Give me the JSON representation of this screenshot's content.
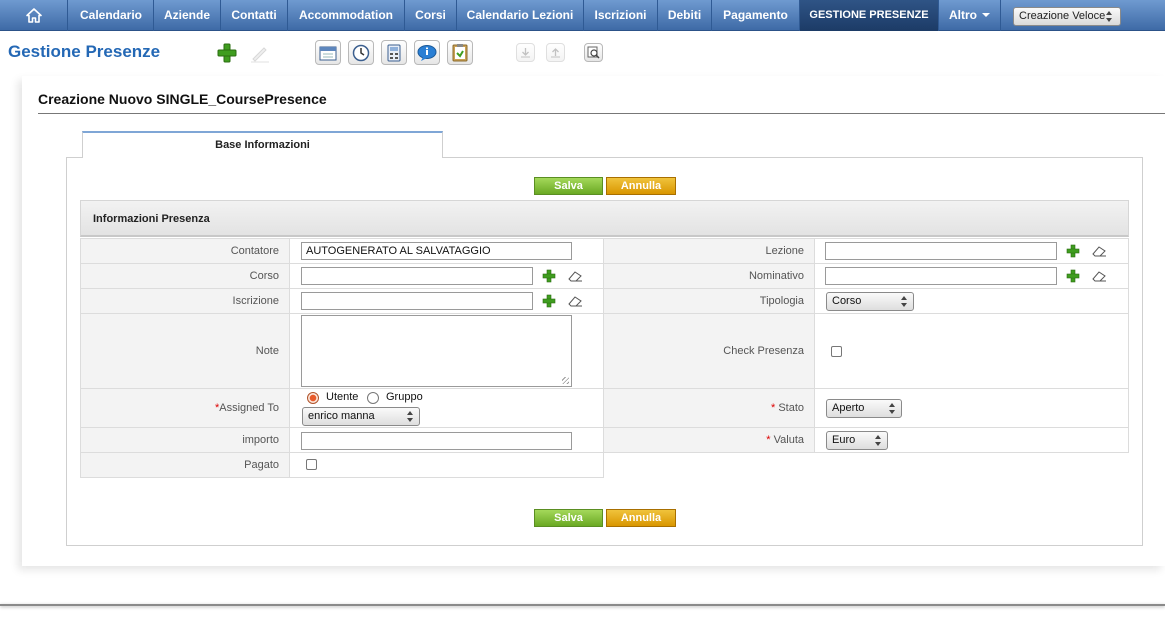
{
  "nav": {
    "home_icon": "home-icon",
    "items": [
      {
        "label": "Calendario",
        "active": false
      },
      {
        "label": "Aziende",
        "active": false
      },
      {
        "label": "Contatti",
        "active": false
      },
      {
        "label": "Accommodation",
        "active": false
      },
      {
        "label": "Corsi",
        "active": false
      },
      {
        "label": "Calendario Lezioni",
        "active": false
      },
      {
        "label": "Iscrizioni",
        "active": false
      },
      {
        "label": "Debiti",
        "active": false
      },
      {
        "label": "Pagamento",
        "active": false
      },
      {
        "label": "GESTIONE PRESENZE",
        "active": true
      },
      {
        "label": "Altro",
        "active": false
      }
    ],
    "quick_create": "Creazione Veloce"
  },
  "header": {
    "module_title": "Gestione Presenze",
    "toolbar_icons": [
      "add-icon",
      "search-edit-icon",
      "calendar-icon",
      "clock-icon",
      "calculator-icon",
      "chat-icon",
      "clipboard-icon",
      "import-icon",
      "export-icon",
      "find-duplicates-icon"
    ]
  },
  "page": {
    "title": "Creazione Nuovo SINGLE_CoursePresence",
    "tab": "Base Informazioni",
    "save_label": "Salva",
    "cancel_label": "Annulla",
    "section_title": "Informazioni Presenza"
  },
  "form": {
    "contatore": {
      "label": "Contatore",
      "value": "AUTOGENERATO AL SALVATAGGIO"
    },
    "lezione": {
      "label": "Lezione",
      "value": ""
    },
    "corso": {
      "label": "Corso",
      "value": ""
    },
    "nominativo": {
      "label": "Nominativo",
      "value": ""
    },
    "iscrizione": {
      "label": "Iscrizione",
      "value": ""
    },
    "tipologia": {
      "label": "Tipologia",
      "value": "Corso"
    },
    "note": {
      "label": "Note",
      "value": ""
    },
    "check_presenza": {
      "label": "Check Presenza",
      "checked": false
    },
    "assigned_to": {
      "label": "Assigned To",
      "radio_user": "Utente",
      "radio_group": "Gruppo",
      "selected": "Utente",
      "user": "enrico manna"
    },
    "stato": {
      "label": "Stato",
      "value": "Aperto"
    },
    "importo": {
      "label": "importo",
      "value": ""
    },
    "valuta": {
      "label": "Valuta",
      "value": "Euro"
    },
    "pagato": {
      "label": "Pagato",
      "checked": false
    }
  },
  "colors": {
    "nav": "#4f7bb8",
    "nav_active": "#24466f",
    "title_blue": "#2468b5",
    "save_green": "#7db73a",
    "cancel_orange": "#e3a513",
    "required_red": "#dd0000"
  }
}
